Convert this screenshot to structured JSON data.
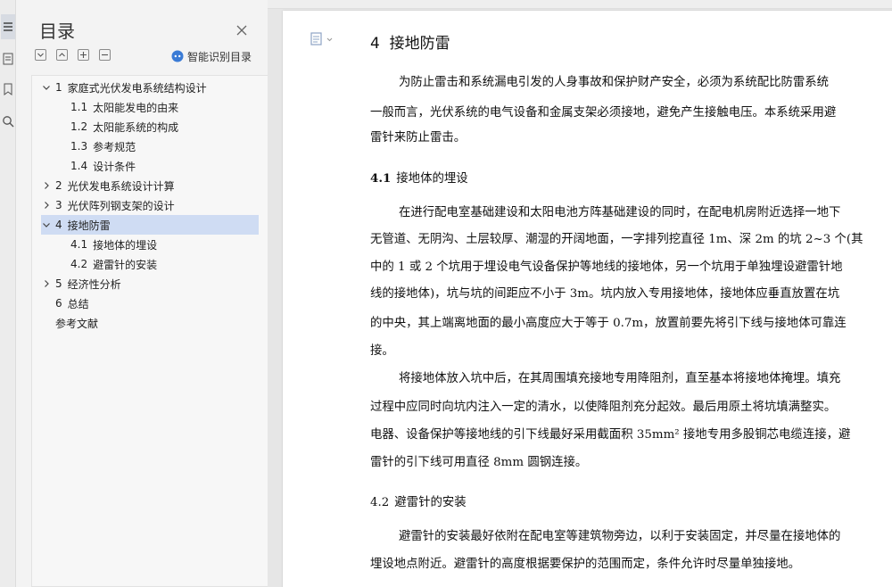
{
  "toc": {
    "title": "目录",
    "smart_label": "智能识别目录",
    "items": [
      {
        "num": "1",
        "label": "家庭式光伏发电系统结构设计",
        "level": 1,
        "expanded": true
      },
      {
        "num": "1.1",
        "label": "太阳能发电的由来",
        "level": 2
      },
      {
        "num": "1.2",
        "label": "太阳能系统的构成",
        "level": 2
      },
      {
        "num": "1.3",
        "label": "参考规范",
        "level": 2
      },
      {
        "num": "1.4",
        "label": "设计条件",
        "level": 2
      },
      {
        "num": "2",
        "label": "光伏发电系统设计计算",
        "level": 1,
        "expanded": false
      },
      {
        "num": "3",
        "label": "光伏阵列钢支架的设计",
        "level": 1,
        "expanded": false
      },
      {
        "num": "4",
        "label": "接地防雷",
        "level": 1,
        "expanded": true,
        "selected": true
      },
      {
        "num": "4.1",
        "label": "接地体的埋设",
        "level": 2
      },
      {
        "num": "4.2",
        "label": "避雷针的安装",
        "level": 2
      },
      {
        "num": "5",
        "label": "经济性分析",
        "level": 1,
        "expanded": false
      },
      {
        "num": "6",
        "label": "总结",
        "level": 1
      },
      {
        "num": "",
        "label": "参考文献",
        "level": 1
      }
    ]
  },
  "document": {
    "heading_num": "4",
    "heading": "接地防雷",
    "lines": [
      "为防止雷击和系统漏电引发的人身事故和保护财产安全，必须为系统配比防雷系统",
      "一般而言，光伏系统的电气设备和金属支架必须接地，避免产生接触电压。本系统采用避",
      "雷针来防止雷击。"
    ],
    "s41_num": "4.1",
    "s41_title": "接地体的埋设",
    "s41_lines": [
      "在进行配电室基础建设和太阳电池方阵基础建设的同时，在配电机房附近选择一地下",
      "无管道、无阴沟、土层较厚、潮湿的开阔地面，一字排列挖直径 1m、深 2m 的坑 2~3 个(其",
      "中的 1 或 2 个坑用于埋设电气设备保护等地线的接地体，另一个坑用于单独埋设避雷针地",
      "线的接地体)，坑与坑的间距应不小于 3m。坑内放入专用接地体，接地体应垂直放置在坑",
      "的中央，其上端离地面的最小高度应大于等于 0.7m，放置前要先将引下线与接地体可靠连",
      "接。",
      "将接地体放入坑中后，在其周围填充接地专用降阻剂，直至基本将接地体掩埋。填充",
      "过程中应同时向坑内注入一定的清水，以使降阻剂充分起效。最后用原土将坑填满整实。",
      "电器、设备保护等接地线的引下线最好采用截面积 35mm² 接地专用多股铜芯电缆连接，避",
      "雷针的引下线可用直径 8mm 圆钢连接。"
    ],
    "s42_num": "4.2",
    "s42_title": "避雷针的安装",
    "s42_lines": [
      "避雷针的安装最好依附在配电室等建筑物旁边，以利于安装固定，并尽量在接地体的",
      "埋设地点附近。避雷针的高度根据要保护的范围而定，条件允许时尽量单独接地。"
    ]
  }
}
